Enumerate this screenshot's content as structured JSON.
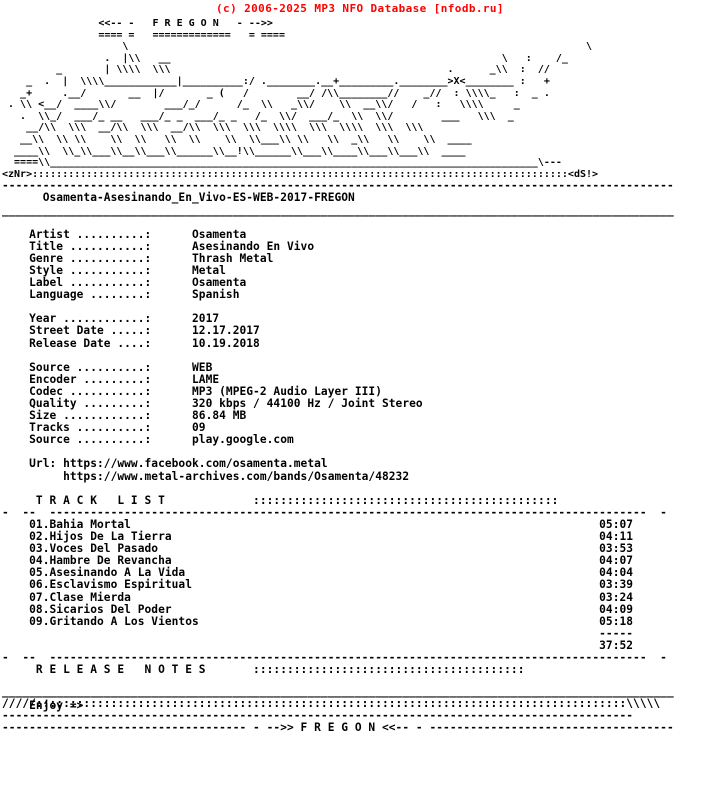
{
  "header": {
    "copyright": "(c) 2006-2025 MP3 NFO Database [nfodb.ru]",
    "color": "#ff0000"
  },
  "logo": {
    "group_banner": "                <<-- -   F R E G O N   - -->>",
    "group_banner_underline": "                ==== =   =============   = ====",
    "signature_left": "<zNr>",
    "signature_right": "<dS!>",
    "art": [
      "                    \\                                                                            \\    ",
      "                 .  |\\\\   __                                                       \\   :    /_     ",
      "         _       | \\\\\\\\  \\\\\\                                              .      _\\\\  :  //      ",
      "    _  .  |  \\\\\\\\____________|__________:/ .________.__+_________.________>X<________ :   +        ",
      "   _+     .__/       __  |/       _ (   /        __/ /\\\\________//    _//  : \\\\\\\\_   :  _ .       ",
      " . \\\\ <__/  ____\\\\/        ___/_/      /_  \\\\   _\\\\/    \\\\  __\\\\/   /   :   \\\\\\\\     _      ",
      "   .  \\\\_/  ___/_ __   ___/_ _  ___/_ _   /_  \\\\/  ___/_  \\\\  \\\\/        ___   \\\\\\  _         ",
      "    __/\\\\  \\\\\\  __/\\\\  \\\\\\  __/\\\\  \\\\\\  \\\\\\  \\\\\\\\  \\\\\\  \\\\\\\\  \\\\\\  \\\\\\   ",
      "   __\\\\  \\\\ \\\\    \\\\  \\\\   \\\\  \\\\    \\\\  \\\\___\\\\ \\\\   \\\\  _\\\\   \\\\    \\\\  ____   ",
      "  ____\\\\  \\\\_\\\\___\\\\__\\\\___\\\\______\\\\__!\\\\______\\\\___\\\\____\\\\___\\\\___\\\\  ____  ",
      "  ====\\\\_________________________________________________________________________________\\---    "
    ]
  },
  "release": {
    "name": "Osamenta-Asesinando_En_Vivo-ES-WEB-2017-FREGON"
  },
  "info": {
    "group1": [
      {
        "label": "Artist",
        "value": "Osamenta"
      },
      {
        "label": "Title",
        "value": "Asesinando En Vivo"
      },
      {
        "label": "Genre",
        "value": "Thrash Metal"
      },
      {
        "label": "Style",
        "value": "Metal"
      },
      {
        "label": "Label",
        "value": "Osamenta"
      },
      {
        "label": "Language",
        "value": "Spanish"
      }
    ],
    "group2": [
      {
        "label": "Year",
        "value": "2017"
      },
      {
        "label": "Street Date",
        "value": "12.17.2017"
      },
      {
        "label": "Release Date",
        "value": "10.19.2018"
      }
    ],
    "group3": [
      {
        "label": "Source",
        "value": "WEB"
      },
      {
        "label": "Encoder",
        "value": "LAME"
      },
      {
        "label": "Codec",
        "value": "MP3 (MPEG-2 Audio Layer III)"
      },
      {
        "label": "Quality",
        "value": "320 kbps / 44100 Hz / Joint Stereo"
      },
      {
        "label": "Size",
        "value": "86.84 MB"
      },
      {
        "label": "Tracks",
        "value": "09"
      },
      {
        "label": "Source",
        "value": "play.google.com"
      }
    ],
    "url_label": "Url:",
    "urls": [
      "https://www.facebook.com/osamenta.metal",
      "https://www.metal-archives.com/bands/Osamenta/48232"
    ]
  },
  "tracklist": {
    "heading": "T R A C K   L I S T",
    "dots": ":::::::::::::::::::::::::::::::::::::::::::::",
    "tracks": [
      {
        "num": "01",
        "title": "Bahia Mortal",
        "time": "05:07"
      },
      {
        "num": "02",
        "title": "Hijos De La Tierra",
        "time": "04:11"
      },
      {
        "num": "03",
        "title": "Voces Del Pasado",
        "time": "03:53"
      },
      {
        "num": "04",
        "title": "Hambre De Revancha",
        "time": "04:07"
      },
      {
        "num": "05",
        "title": "Asesinando A La Vida",
        "time": "04:04"
      },
      {
        "num": "06",
        "title": "Esclavismo Espiritual",
        "time": "03:39"
      },
      {
        "num": "07",
        "title": "Clase Mierda",
        "time": "03:24"
      },
      {
        "num": "08",
        "title": "Sicarios Del Poder",
        "time": "04:09"
      },
      {
        "num": "09",
        "title": "Gritando A Los Vientos",
        "time": "05:18"
      }
    ],
    "total_rule": "-----",
    "total_time": "37:52"
  },
  "notes": {
    "heading": "R E L E A S E   N O T E S",
    "dots": "::::::::::::::::::::::::::::::::::::::::",
    "body": "Enjoy =>"
  },
  "footer": {
    "line1": "/////:::::::::::::::::::::::::::::::::::::::::::::::::::::::::::::::::::::::::::::::::::::::\\\\\\\\\\",
    "line2": "---------------------------------------------------------------------------------------------",
    "line3": "-------------------------  - -->> F R E G O N <<-- -  -------------------------"
  }
}
